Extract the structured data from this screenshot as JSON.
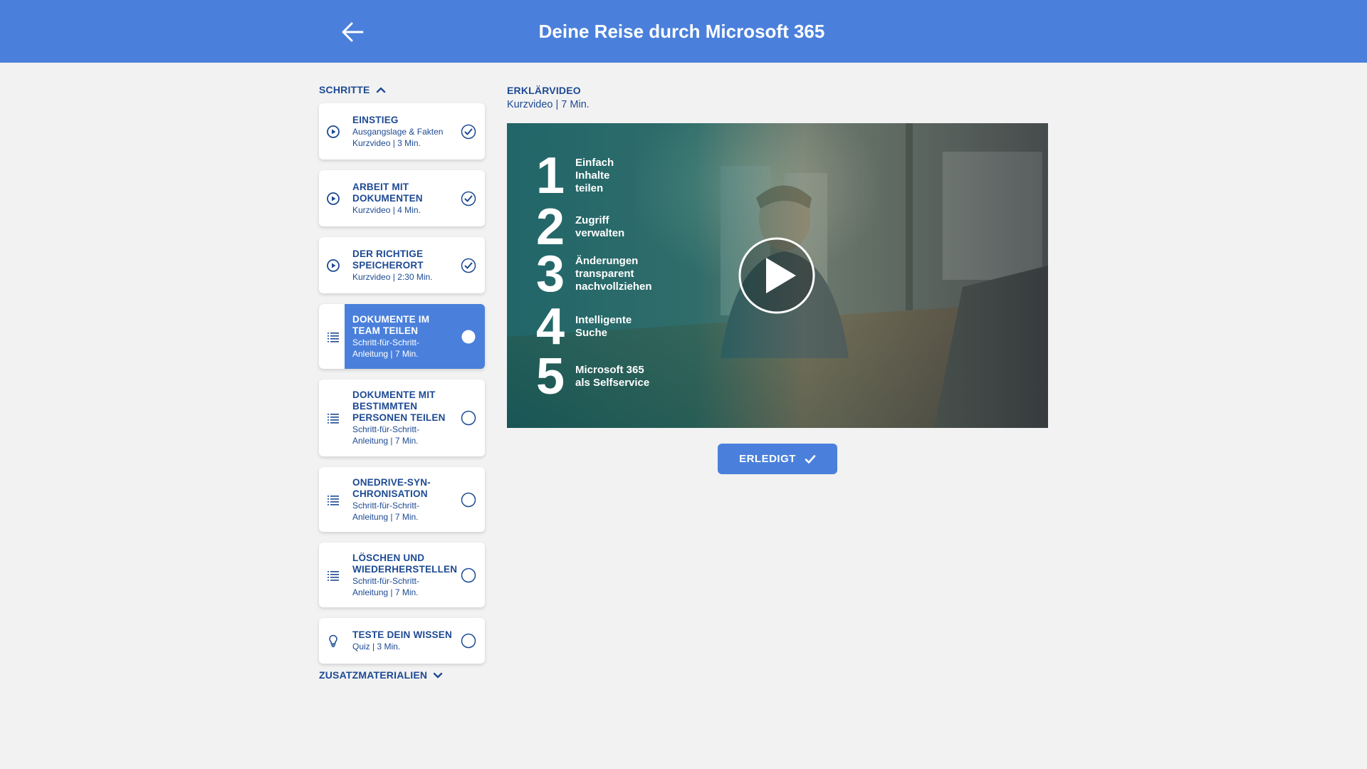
{
  "header": {
    "title": "Deine Reise durch Microsoft 365",
    "back_icon": "arrow-left-icon"
  },
  "sidebar": {
    "steps_label": "SCHRITTE",
    "extras_label": "ZUSATZMATERIALIEN",
    "items": [
      {
        "title": "EINSTIEG",
        "sub1": "Ausgangslage & Fakten",
        "sub2": "Kurzvideo | 3 Min.",
        "type_icon": "play-circle-icon",
        "status": "done"
      },
      {
        "title": "ARBEIT MIT",
        "title2": "DOKUMENTEN",
        "sub1": "Kurzvideo | 4 Min.",
        "type_icon": "play-circle-icon",
        "status": "done"
      },
      {
        "title": "DER RICHTIGE",
        "title2": "SPEICHERORT",
        "sub1": "Kurzvideo | 2:30 Min.",
        "type_icon": "play-circle-icon",
        "status": "done"
      },
      {
        "title": "DOKUMENTE IM",
        "title2": "TEAM TEILEN",
        "sub1": "Schritt-für-Schritt-",
        "sub2": "Anleitung | 7 Min.",
        "type_icon": "list-icon",
        "status": "active"
      },
      {
        "title": "DOKUMENTE MIT",
        "title2": "BESTIMMTEN",
        "title3": "PERSONEN TEILEN",
        "sub1": "Schritt-für-Schritt-",
        "sub2": "Anleitung | 7 Min.",
        "type_icon": "list-icon",
        "status": "open"
      },
      {
        "title": "ONEDRIVE-SYN-",
        "title2": "CHRONISATION",
        "sub1": "Schritt-für-Schritt-",
        "sub2": "Anleitung | 7 Min.",
        "type_icon": "list-icon",
        "status": "open"
      },
      {
        "title": "LÖSCHEN UND",
        "title2": "WIEDERHERSTELLEN",
        "sub1": "Schritt-für-Schritt-",
        "sub2": "Anleitung | 7 Min.",
        "type_icon": "list-icon",
        "status": "open"
      },
      {
        "title": "TESTE DEIN WISSEN",
        "sub1": "Quiz | 3 Min.",
        "type_icon": "lightbulb-icon",
        "status": "open"
      }
    ]
  },
  "content": {
    "label": "ERKLÄRVIDEO",
    "meta": "Kurzvideo | 7 Min.",
    "video_steps": [
      {
        "num": "1",
        "text1": "Einfach",
        "text2": "Inhalte",
        "text3": "teilen"
      },
      {
        "num": "2",
        "text1": "Zugriff",
        "text2": "verwalten"
      },
      {
        "num": "3",
        "text1": "Änderungen",
        "text2": "transparent",
        "text3": "nachvollziehen"
      },
      {
        "num": "4",
        "text1": "Intelligente",
        "text2": "Suche"
      },
      {
        "num": "5",
        "text1": "Microsoft 365",
        "text2": "als Selfservice"
      }
    ],
    "done_label": "ERLEDIGT"
  },
  "colors": {
    "accent": "#4a80db",
    "text": "#1d4a93",
    "background": "#f2f2f2",
    "video_teal": "#0b6166"
  }
}
